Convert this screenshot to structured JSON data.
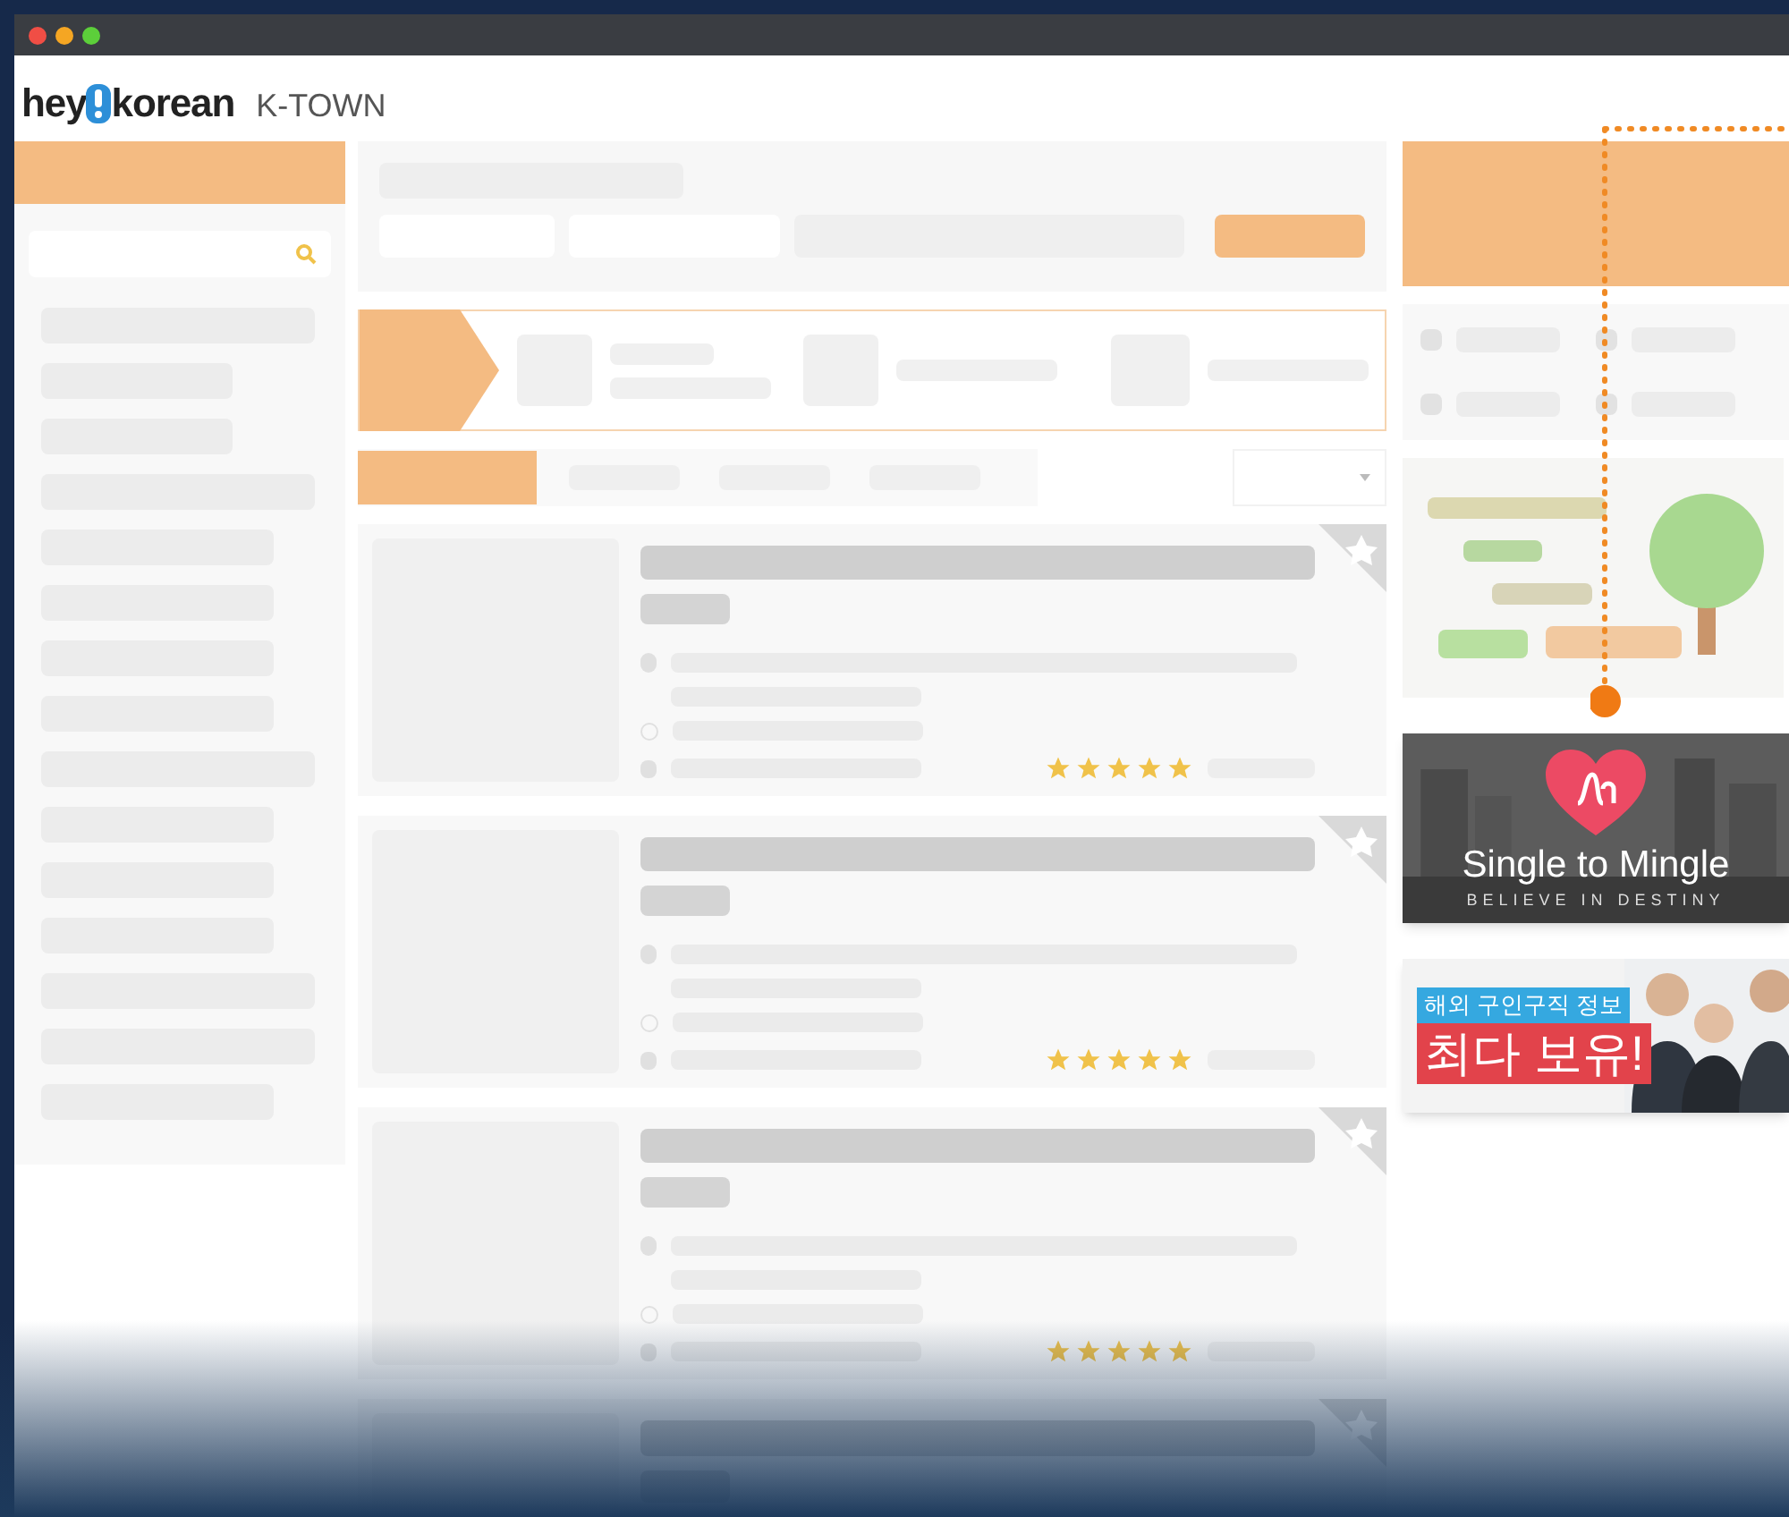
{
  "logo": {
    "brand_start": "hey",
    "brand_end": "korean",
    "section": "K-TOWN"
  },
  "sort_tabs": [
    {
      "selected": true
    },
    {
      "selected": false
    },
    {
      "selected": false
    },
    {
      "selected": false
    }
  ],
  "listings": [
    {
      "stars": 5
    },
    {
      "stars": 5
    },
    {
      "stars": 5
    }
  ],
  "ads": [
    {
      "kind": "picture"
    },
    {
      "kind": "dating",
      "title": "Single to Mingle",
      "tagline": "BELIEVE IN DESTINY"
    },
    {
      "kind": "jobs",
      "headline": "해외 구인구직 정보",
      "subline": "최다 보유!"
    }
  ]
}
